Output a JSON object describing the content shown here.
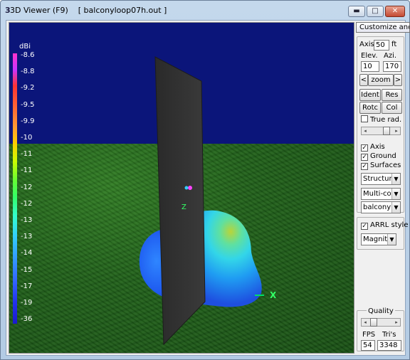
{
  "window": {
    "title": "3D Viewer (F9)    [ balconyloop07h.out ]",
    "icon": "3",
    "buttons": {
      "minimize": "▬",
      "maximize": "□",
      "close": "✕"
    }
  },
  "tooltip": "Customize and c",
  "colorscale": {
    "unit": "dBi",
    "ticks": [
      "-8.6",
      "-8.8",
      "-9.2",
      "-9.5",
      "-9.9",
      "-10",
      "-11",
      "-11",
      "-12",
      "-12",
      "-13",
      "-13",
      "-14",
      "-15",
      "-17",
      "-19",
      "-36"
    ]
  },
  "scene": {
    "axis_x_label": "X",
    "axis_z_label": "Z"
  },
  "panel": {
    "axis_label": "Axis",
    "axis_value": "50",
    "axis_unit": "ft",
    "elev_label": "Elev.",
    "azi_label": "Azi.",
    "elev_value": "10",
    "azi_value": "170",
    "zoom_left": "<",
    "zoom_label": "zoom",
    "zoom_right": ">",
    "ident": "Ident",
    "res": "Res",
    "rotc": "Rotc",
    "col": "Col",
    "true_rad": "True rad.",
    "true_rad_checked": false,
    "axis_check": "Axis",
    "axis_checked": true,
    "ground_check": "Ground",
    "ground_checked": true,
    "surfaces_check": "Surfaces",
    "surfaces_checked": true,
    "select1": "Structure",
    "select2": "Multi-colo",
    "select3": "balconylo",
    "arrl_check": "ARRL style",
    "arrl_checked": true,
    "select4": "Magnitu",
    "quality_label": "Quality",
    "fps_label": "FPS",
    "tris_label": "Tri's",
    "fps_value": "54",
    "tris_value": "3348"
  }
}
